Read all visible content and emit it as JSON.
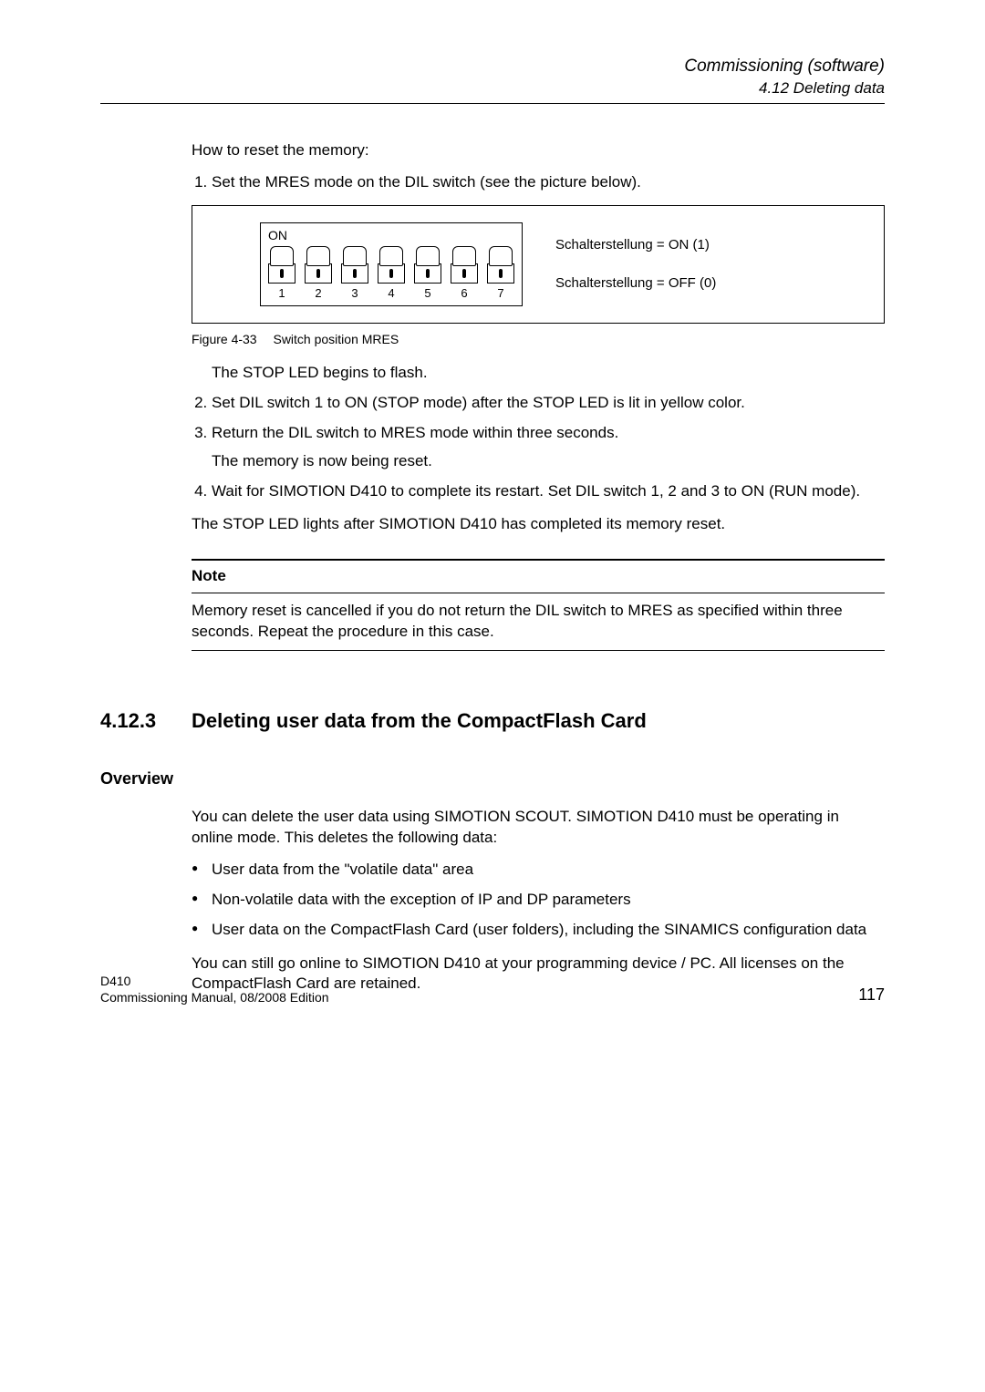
{
  "header": {
    "title": "Commissioning (software)",
    "subtitle": "4.12 Deleting data"
  },
  "intro": "How to reset the memory:",
  "step1": "Set the MRES mode on the DIL switch (see the picture below).",
  "figure": {
    "on_label": "ON",
    "switch_numbers": [
      "1",
      "2",
      "3",
      "4",
      "5",
      "6",
      "7"
    ],
    "label_on": "Schalterstellung = ON (1)",
    "label_off": "Schalterstellung = OFF (0)",
    "caption_num": "Figure 4-33",
    "caption_text": "Switch position MRES"
  },
  "step1_sub": "The STOP LED begins to flash.",
  "step2": "Set DIL switch 1 to ON (STOP mode) after the STOP LED is lit in yellow color.",
  "step3": "Return the DIL switch to MRES mode within three seconds.",
  "step3_sub": "The memory is now being reset.",
  "step4": "Wait for SIMOTION D410 to complete its restart. Set DIL switch 1, 2 and 3 to ON (RUN mode).",
  "after_steps": "The STOP LED lights after SIMOTION D410 has completed its memory reset.",
  "note": {
    "label": "Note",
    "text": "Memory reset is cancelled if you do not return the DIL switch to MRES as specified within three seconds. Repeat the procedure in this case."
  },
  "section": {
    "number": "4.12.3",
    "title": "Deleting user data from the CompactFlash Card"
  },
  "overview": {
    "heading": "Overview",
    "intro": "You can delete the user data using SIMOTION SCOUT. SIMOTION D410 must be operating in online mode. This deletes the following data:",
    "bullets": [
      "User data from the \"volatile data\" area",
      "Non-volatile data with the exception of IP and DP parameters",
      "User data on the CompactFlash Card (user folders), including the SINAMICS configuration data"
    ],
    "outro": "You can still go online to SIMOTION D410 at your programming device / PC. All licenses on the CompactFlash Card are retained."
  },
  "footer": {
    "line1": "D410",
    "line2": "Commissioning Manual, 08/2008 Edition",
    "page": "117"
  }
}
